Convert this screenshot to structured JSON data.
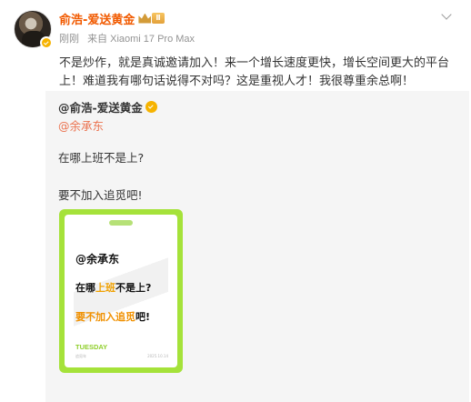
{
  "post": {
    "author": "俞浩-爱送黄金",
    "level": "Ⅱ",
    "time": "刚刚",
    "source": "来自 Xiaomi 17 Pro Max",
    "text": "不是炒作，就是真诚邀请加入！来一个增长速度更快，增长空间更大的平台上！难道我有哪句话说得不对吗？这是重视人才！我很尊重余总啊！"
  },
  "repost": {
    "author": "@俞浩-爱送黄金",
    "mention": "@余承东",
    "line1": "在哪上班不是上?",
    "line2": "要不加入追觅吧!"
  },
  "poster": {
    "mention": "@余承东",
    "q_a": "在哪",
    "q_hl": "上班",
    "q_b": "不是上?",
    "a_hl": "要不加入追觅",
    "a_b": "吧!",
    "day": "TUESDAY",
    "foot_left": "追觅年",
    "foot_right": "2025.10.14"
  },
  "colors": {
    "accent": "#f15a00",
    "mention": "#eb7350",
    "poster_frame": "#a5e23a"
  },
  "icons": [
    "verified-icon",
    "crown-icon",
    "chevron-down-icon"
  ]
}
